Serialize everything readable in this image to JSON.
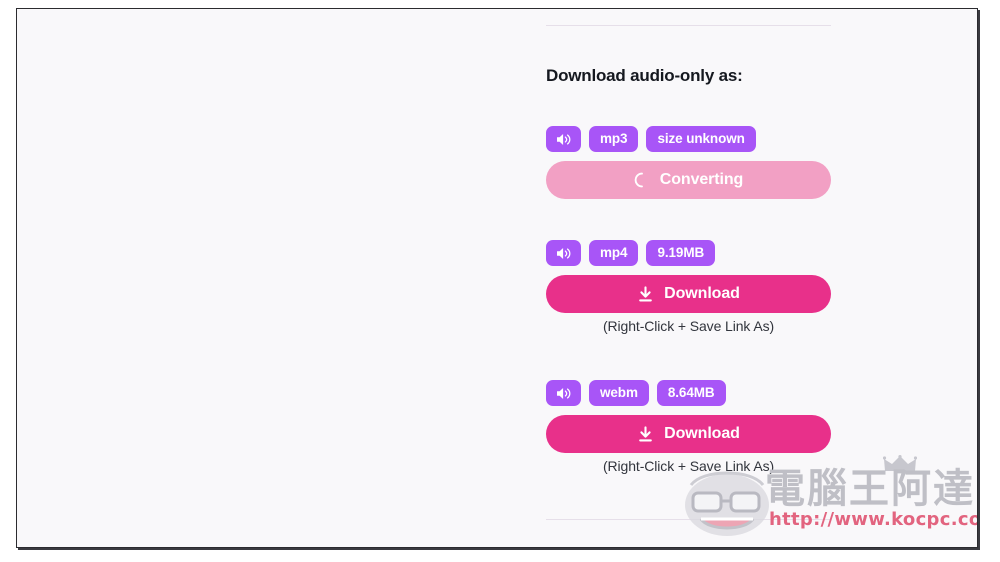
{
  "page": {
    "background_color": "#f9f8fa",
    "section_title": "Download audio-only as:",
    "divider_color": "#e6dfe9"
  },
  "colors": {
    "badge_purple": "#a855f7",
    "download_pink": "#e8308a",
    "converting_pink": "#f2a0c4",
    "title_text": "#15181f",
    "hint_text": "#32353d"
  },
  "formats": [
    {
      "id": "mp3",
      "audio_icon": "speaker-volume-icon",
      "format_label": "mp3",
      "size_label": "size unknown",
      "action": {
        "state": "converting",
        "label": "Converting",
        "icon": "spinner-icon"
      },
      "hint": ""
    },
    {
      "id": "mp4",
      "audio_icon": "speaker-volume-icon",
      "format_label": "mp4",
      "size_label": "9.19MB",
      "action": {
        "state": "ready",
        "label": "Download",
        "icon": "download-arrow-icon"
      },
      "hint": "(Right-Click + Save Link As)"
    },
    {
      "id": "webm",
      "audio_icon": "speaker-volume-icon",
      "format_label": "webm",
      "size_label": "8.64MB",
      "action": {
        "state": "ready",
        "label": "Download",
        "icon": "download-arrow-icon"
      },
      "hint": "(Right-Click + Save Link As)"
    }
  ],
  "watermark": {
    "brand_text": "電腦王阿達",
    "url_text": "http://www.kocpc.com.tw",
    "mascot_icon": "cartoon-face-with-glasses-icon",
    "crown_icon": "crown-icon",
    "brand_color": "#bfbfc6",
    "url_color": "#e2647f"
  }
}
